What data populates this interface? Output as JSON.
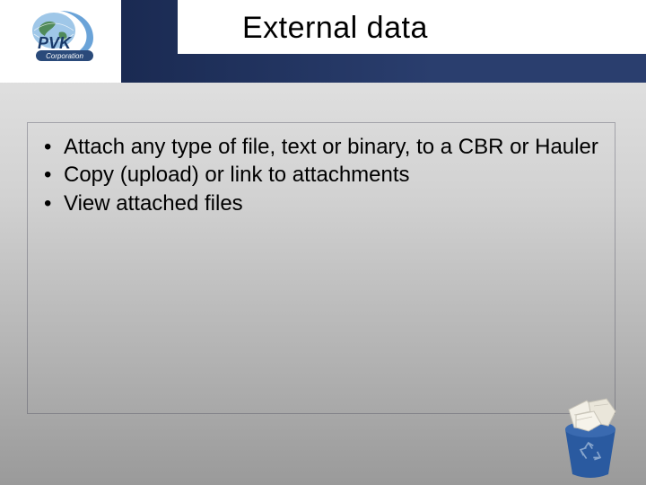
{
  "logo": {
    "company": "PVK",
    "subtitle": "Corporation"
  },
  "title": "External data",
  "bullets": [
    "Attach any type of file, text or binary, to a CBR or Hauler",
    "Copy (upload) or link to attachments",
    "View attached files"
  ]
}
